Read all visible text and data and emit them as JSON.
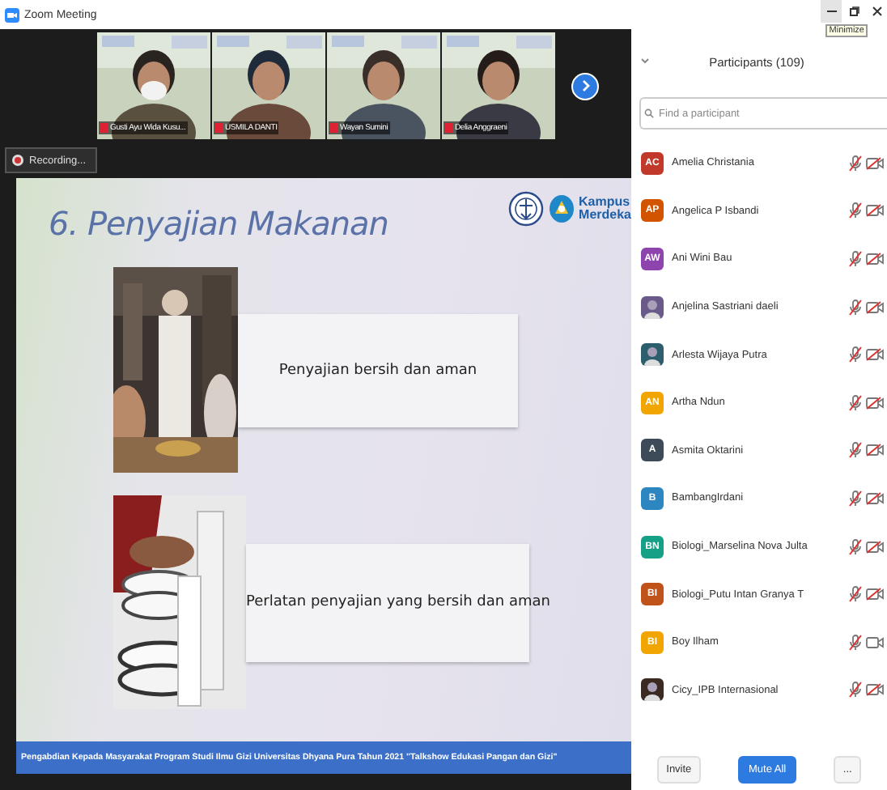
{
  "window": {
    "title": "Zoom Meeting",
    "tooltip": "Minimize"
  },
  "videos": [
    {
      "name": "Gusti Ayu Wida Kusu..."
    },
    {
      "name": "USMILA DANTI"
    },
    {
      "name": "Wayan Sumini"
    },
    {
      "name": "Delia Anggraeni"
    }
  ],
  "recording": {
    "label": "Recording..."
  },
  "slide": {
    "title": "6. Penyajian Makanan",
    "logo_text": [
      "Kampus",
      "Merdeka"
    ],
    "items": [
      {
        "text": "Penyajian bersih dan aman"
      },
      {
        "text": "Perlatan penyajian yang bersih dan aman"
      }
    ],
    "banner": "Pengabdian Kepada Masyarakat Program Studi Ilmu Gizi Universitas Dhyana Pura Tahun 2021 \"Talkshow Edukasi Pangan dan Gizi\""
  },
  "participants": {
    "title": "Participants (109)",
    "search": {
      "placeholder": "Find a participant"
    },
    "people": [
      {
        "name": "Amelia Christania",
        "kind": "initials",
        "initials": "AC",
        "color": "#c0392b",
        "audio_muted": true,
        "video_off": true
      },
      {
        "name": "Angelica P Isbandi",
        "kind": "initials",
        "initials": "AP",
        "color": "#d35400",
        "audio_muted": true,
        "video_off": true
      },
      {
        "name": "Ani Wini Bau",
        "kind": "initials",
        "initials": "AW",
        "color": "#8e44ad",
        "audio_muted": true,
        "video_off": true
      },
      {
        "name": "Anjelina Sastriani daeli",
        "audio_muted": true,
        "video_off": true
      },
      {
        "name": "Arlesta Wijaya Putra",
        "audio_muted": true,
        "video_off": true
      },
      {
        "name": "Artha Ndun",
        "kind": "initials",
        "initials": "AN",
        "color": "#f0a500",
        "audio_muted": true,
        "video_off": true
      },
      {
        "name": "Asmita Oktarini",
        "kind": "initials",
        "initials": "A",
        "color": "#3d4a57",
        "audio_muted": true,
        "video_off": true
      },
      {
        "name": "BambangIrdani",
        "kind": "initials",
        "initials": "B",
        "color": "#2e86c1",
        "audio_muted": true,
        "video_off": true
      },
      {
        "name": "Biologi_Marselina Nova Julta",
        "kind": "initials",
        "initials": "BN",
        "color": "#16a085",
        "audio_muted": true,
        "video_off": true
      },
      {
        "name": "Biologi_Putu Intan Granya T",
        "kind": "initials",
        "initials": "BI",
        "color": "#c0531a",
        "audio_muted": true,
        "video_off": true
      },
      {
        "name": "Boy Ilham",
        "kind": "initials",
        "initials": "BI",
        "color": "#f0a500",
        "audio_muted": true,
        "video_off": false
      },
      {
        "name": "Cicy_IPB Internasional",
        "audio_muted": true,
        "video_off": true
      }
    ],
    "buttons": [
      {
        "label": "Invite",
        "kind": "plain"
      },
      {
        "label": "Mute All",
        "kind": "primary"
      },
      {
        "label": "...",
        "kind": "plain"
      }
    ]
  }
}
